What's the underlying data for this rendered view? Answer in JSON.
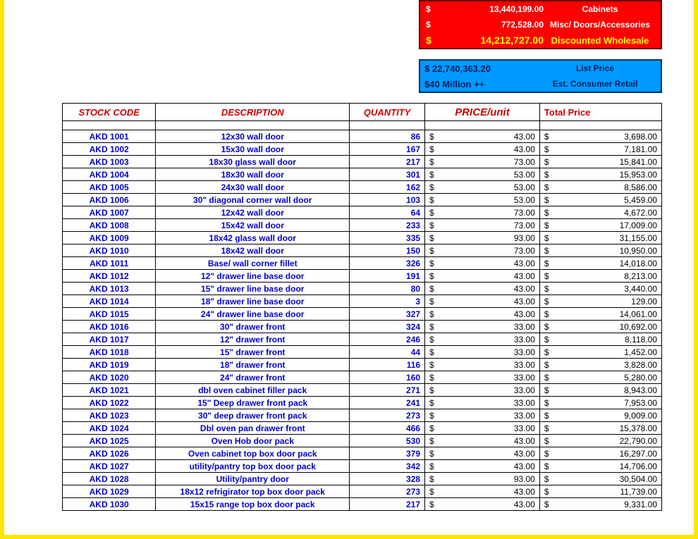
{
  "summary": {
    "red": [
      {
        "amount": "13,440,199.00",
        "label": "Cabinets",
        "big": false
      },
      {
        "amount": "772,528.00",
        "label": "Misc/ Doors/Accessories",
        "big": false
      },
      {
        "amount": "14,212,727.00",
        "label": "Discounted Wholesale",
        "big": true
      }
    ],
    "blue": [
      {
        "amount": "$  22,740,363.20",
        "label": "List Price"
      },
      {
        "amount": "$40 Million ++",
        "label": "Est. Consumer Retail"
      }
    ]
  },
  "headers": {
    "code": "STOCK CODE",
    "desc": "DESCRIPTION",
    "qty": "QUANTITY",
    "price": "PRICE/unit",
    "total": "Total Price"
  },
  "rows": [
    {
      "code": "AKD 1001",
      "desc": "12x30 wall door",
      "qty": "86",
      "price": "43.00",
      "total": "3,698.00"
    },
    {
      "code": "AKD 1002",
      "desc": "15x30 wall door",
      "qty": "167",
      "price": "43.00",
      "total": "7,181.00"
    },
    {
      "code": "AKD 1003",
      "desc": "18x30 glass wall door",
      "qty": "217",
      "price": "73.00",
      "total": "15,841.00"
    },
    {
      "code": "AKD 1004",
      "desc": "18x30 wall door",
      "qty": "301",
      "price": "53.00",
      "total": "15,953.00"
    },
    {
      "code": "AKD 1005",
      "desc": "24x30 wall door",
      "qty": "162",
      "price": "53.00",
      "total": "8,586.00"
    },
    {
      "code": "AKD 1006",
      "desc": "30\" diagonal corner wall door",
      "qty": "103",
      "price": "53.00",
      "total": "5,459.00"
    },
    {
      "code": "AKD 1007",
      "desc": "12x42 wall door",
      "qty": "64",
      "price": "73.00",
      "total": "4,672.00"
    },
    {
      "code": "AKD 1008",
      "desc": "15x42 wall door",
      "qty": "233",
      "price": "73.00",
      "total": "17,009.00"
    },
    {
      "code": "AKD 1009",
      "desc": "18x42 glass wall door",
      "qty": "335",
      "price": "93.00",
      "total": "31,155.00"
    },
    {
      "code": "AKD 1010",
      "desc": "18x42 wall door",
      "qty": "150",
      "price": "73.00",
      "total": "10,950.00"
    },
    {
      "code": "AKD 1011",
      "desc": "Base/ wall corner fillet",
      "qty": "326",
      "price": "43.00",
      "total": "14,018.00"
    },
    {
      "code": "AKD 1012",
      "desc": "12\" drawer line base door",
      "qty": "191",
      "price": "43.00",
      "total": "8,213.00"
    },
    {
      "code": "AKD 1013",
      "desc": "15\" drawer line base door",
      "qty": "80",
      "price": "43.00",
      "total": "3,440.00"
    },
    {
      "code": "AKD 1014",
      "desc": "18\" drawer line base door",
      "qty": "3",
      "price": "43.00",
      "total": "129.00"
    },
    {
      "code": "AKD 1015",
      "desc": "24\" drawer line base door",
      "qty": "327",
      "price": "43.00",
      "total": "14,061.00"
    },
    {
      "code": "AKD 1016",
      "desc": "30\" drawer front",
      "qty": "324",
      "price": "33.00",
      "total": "10,692.00"
    },
    {
      "code": "AKD 1017",
      "desc": "12\" drawer front",
      "qty": "246",
      "price": "33.00",
      "total": "8,118.00"
    },
    {
      "code": "AKD 1018",
      "desc": "15\" drawer front",
      "qty": "44",
      "price": "33.00",
      "total": "1,452.00"
    },
    {
      "code": "AKD 1019",
      "desc": "18\" drawer front",
      "qty": "116",
      "price": "33.00",
      "total": "3,828.00"
    },
    {
      "code": "AKD 1020",
      "desc": "24\" drawer front",
      "qty": "160",
      "price": "33.00",
      "total": "5,280.00"
    },
    {
      "code": "AKD 1021",
      "desc": "dbl oven cabinet filler pack",
      "qty": "271",
      "price": "33.00",
      "total": "8,943.00"
    },
    {
      "code": "AKD 1022",
      "desc": "15\" Deep drawer front pack",
      "qty": "241",
      "price": "33.00",
      "total": "7,953.00"
    },
    {
      "code": "AKD 1023",
      "desc": "30\" deep drawer front pack",
      "qty": "273",
      "price": "33.00",
      "total": "9,009.00"
    },
    {
      "code": "AKD 1024",
      "desc": "Dbl oven pan drawer front",
      "qty": "466",
      "price": "33.00",
      "total": "15,378.00"
    },
    {
      "code": "AKD 1025",
      "desc": "Oven Hob door pack",
      "qty": "530",
      "price": "43.00",
      "total": "22,790.00"
    },
    {
      "code": "AKD 1026",
      "desc": "Oven cabinet top box door pack",
      "qty": "379",
      "price": "43.00",
      "total": "16,297.00"
    },
    {
      "code": "AKD 1027",
      "desc": "utility/pantry top box door pack",
      "qty": "342",
      "price": "43.00",
      "total": "14,706.00"
    },
    {
      "code": "AKD 1028",
      "desc": "Utility/pantry door",
      "qty": "328",
      "price": "93.00",
      "total": "30,504.00"
    },
    {
      "code": "AKD 1029",
      "desc": "18x12 refrigirator top box door pack",
      "qty": "273",
      "price": "43.00",
      "total": "11,739.00"
    },
    {
      "code": "AKD 1030",
      "desc": "15x15 range top box door pack",
      "qty": "217",
      "price": "43.00",
      "total": "9,331.00"
    }
  ]
}
